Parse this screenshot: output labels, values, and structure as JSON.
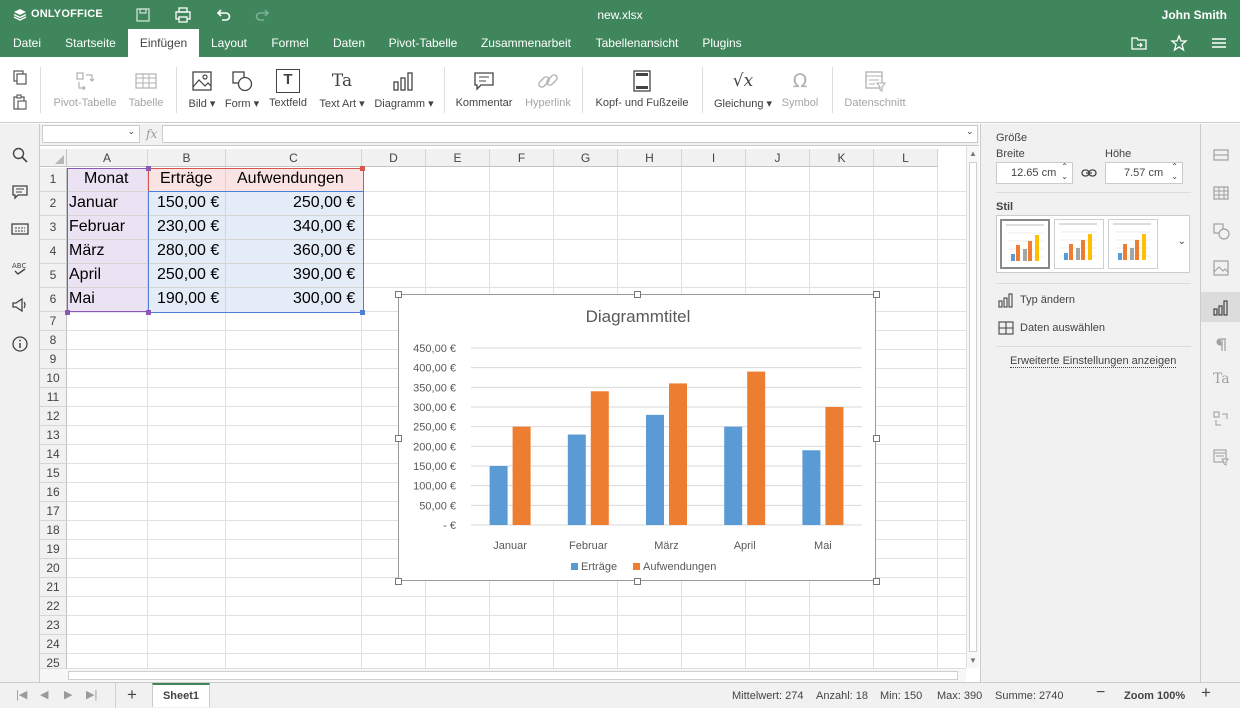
{
  "app": {
    "logo": "ONLYOFFICE",
    "file_name": "new.xlsx",
    "user": "John Smith"
  },
  "menu_tabs": [
    "Datei",
    "Startseite",
    "Einfügen",
    "Layout",
    "Formel",
    "Daten",
    "Pivot-Tabelle",
    "Zusammenarbeit",
    "Tabellenansicht",
    "Plugins"
  ],
  "active_tab": "Einfügen",
  "toolbar": {
    "pivot_table": "Pivot-Tabelle",
    "table": "Tabelle",
    "image": "Bild",
    "shape": "Form",
    "textbox": "Textfeld",
    "text_art": "Text Art",
    "chart": "Diagramm",
    "comment": "Kommentar",
    "hyperlink": "Hyperlink",
    "header_footer": "Kopf- und Fußzeile",
    "equation": "Gleichung",
    "symbol": "Symbol",
    "slicer": "Datenschnitt",
    "equation_glyph": "√x",
    "symbol_glyph": "Ω",
    "text_art_glyph": "Ta",
    "textbox_glyph": "T"
  },
  "formula_bar": {
    "name_box": "",
    "fx_label": "fx",
    "value": ""
  },
  "grid": {
    "columns": [
      "A",
      "B",
      "C",
      "D",
      "E",
      "F",
      "G",
      "H",
      "I",
      "J",
      "K",
      "L"
    ],
    "rows": [
      "1",
      "2",
      "3",
      "4",
      "5",
      "6",
      "7",
      "8",
      "9",
      "10",
      "11",
      "12",
      "13",
      "14",
      "15",
      "16",
      "17",
      "18",
      "19",
      "20",
      "21",
      "22",
      "23",
      "24",
      "25"
    ],
    "headers": [
      "Monat",
      "Erträge",
      "Aufwendungen"
    ],
    "data": [
      [
        "Januar",
        "150,00 €",
        "250,00 €"
      ],
      [
        "Februar",
        "230,00 €",
        "340,00 €"
      ],
      [
        "März",
        "280,00 €",
        "360,00 €"
      ],
      [
        "April",
        "250,00 €",
        "390,00 €"
      ],
      [
        "Mai",
        "190,00 €",
        "300,00 €"
      ]
    ]
  },
  "chart_data": {
    "type": "bar",
    "title": "Diagrammtitel",
    "categories": [
      "Januar",
      "Februar",
      "März",
      "April",
      "Mai"
    ],
    "series": [
      {
        "name": "Erträge",
        "values": [
          150,
          230,
          280,
          250,
          190
        ],
        "color": "#5b9bd5"
      },
      {
        "name": "Aufwendungen",
        "values": [
          250,
          340,
          360,
          390,
          300
        ],
        "color": "#ed7d31"
      }
    ],
    "ylim": [
      0,
      450
    ],
    "yticks": [
      "- €",
      "50,00 €",
      "100,00 €",
      "150,00 €",
      "200,00 €",
      "250,00 €",
      "300,00 €",
      "350,00 €",
      "400,00 €",
      "450,00 €"
    ],
    "grid": true,
    "legend": "bottom"
  },
  "right_panel": {
    "size_label": "Größe",
    "width_label": "Breite",
    "width_value": "12.65 cm",
    "height_label": "Höhe",
    "height_value": "7.57 cm",
    "style_label": "Stil",
    "change_type": "Typ ändern",
    "select_data": "Daten auswählen",
    "advanced": "Erweiterte Einstellungen anzeigen"
  },
  "statusbar": {
    "sheet_tab": "Sheet1",
    "average": "Mittelwert: 274",
    "count": "Anzahl: 18",
    "min": "Min: 150",
    "max": "Max: 390",
    "sum": "Summe: 2740",
    "zoom": "Zoom 100%"
  },
  "colors": {
    "brand": "#40865c",
    "series1": "#5b9bd5",
    "series2": "#ed7d31"
  }
}
